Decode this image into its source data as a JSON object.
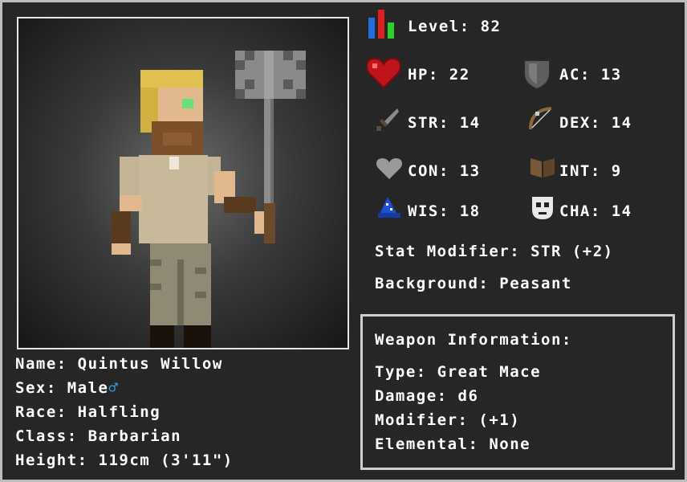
{
  "stats": {
    "level": "Level: 82",
    "hp": "HP: 22",
    "ac": "AC: 13",
    "str": "STR: 14",
    "dex": "DEX: 14",
    "con": "CON: 13",
    "int": "INT: 9",
    "wis": "WIS: 18",
    "cha": "CHA: 14",
    "stat_modifier": "Stat Modifier: STR (+2)",
    "background": "Background: Peasant"
  },
  "character": {
    "name": "Name: Quintus Willow",
    "sex": "Sex: Male",
    "sex_symbol": "♂",
    "race": "Race: Halfling",
    "class": "Class: Barbarian",
    "height": "Height: 119cm (3'11\")"
  },
  "weapon": {
    "title": "Weapon Information:",
    "type": "Type: Great Mace",
    "damage": "Damage: d6",
    "modifier": "Modifier: (+1)",
    "elemental": "Elemental: None"
  },
  "colors": {
    "background": "#262626",
    "frame": "#bdbdbd",
    "text": "#ffffff",
    "male_symbol": "#3aa0e8",
    "hp_heart": "#c0141c"
  },
  "icons": {
    "level": "bar-chart-icon",
    "hp": "heart-icon",
    "ac": "shield-icon",
    "str": "sword-icon",
    "dex": "bow-icon",
    "con": "gray-heart-icon",
    "int": "book-icon",
    "wis": "wizard-hat-icon",
    "cha": "mask-icon"
  }
}
